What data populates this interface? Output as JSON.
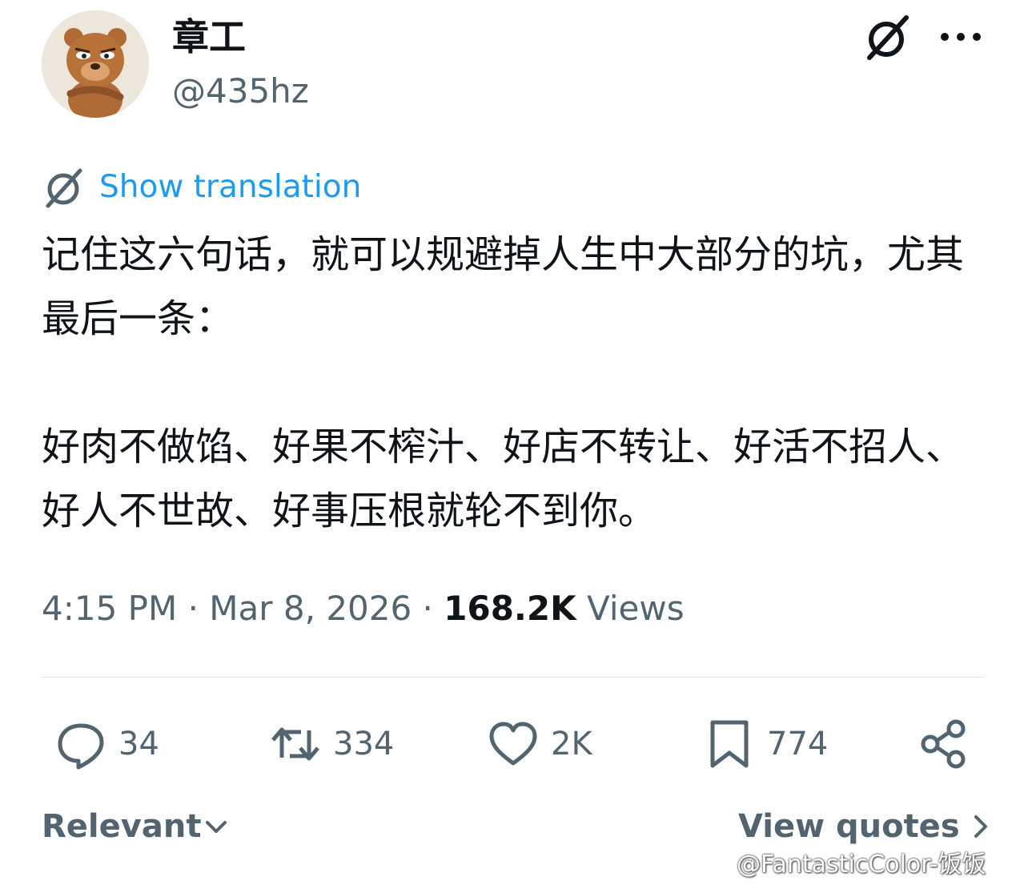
{
  "author": {
    "display_name": "章工",
    "handle": "@435hz",
    "avatar_icon": "cartoon-bear-avatar"
  },
  "header_icons": [
    "grok-icon",
    "more-icon"
  ],
  "translation": {
    "label": "Show translation",
    "icon": "grok-icon",
    "color": "#1d9bf0"
  },
  "tweet": {
    "text": "记住这六句话，就可以规避掉人生中大部分的坑，尤其最后一条：\n\n好肉不做馅、好果不榨汁、好店不转让、好活不招人、好人不世故、好事压根就轮不到你。"
  },
  "meta": {
    "time": "4:15 PM",
    "separator": " · ",
    "date": "Mar 8, 2026",
    "views_count": "168.2K",
    "views_label": "Views"
  },
  "actions": {
    "replies": "34",
    "reposts": "334",
    "likes": "2K",
    "bookmarks": "774"
  },
  "footer": {
    "sort_label": "Relevant",
    "quotes_label": "View quotes"
  },
  "watermark": {
    "text": "@FantasticColor-饭饭",
    "icon": "weibo-icon"
  },
  "colors": {
    "accent": "#1d9bf0",
    "text_primary": "#0f1419",
    "text_secondary": "#536471"
  }
}
